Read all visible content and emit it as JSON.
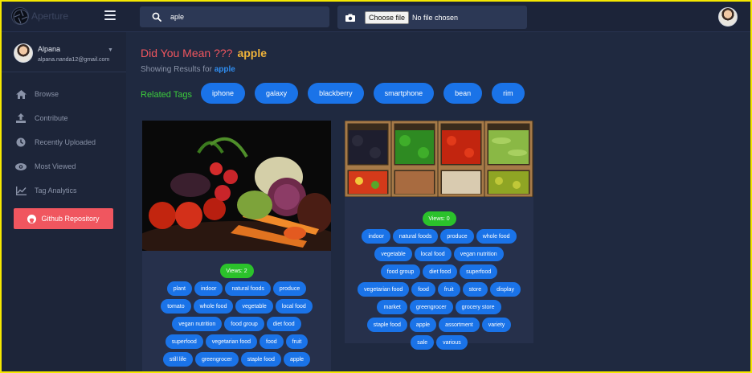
{
  "header": {
    "app_name": "Aperture",
    "search": {
      "value": "aple",
      "placeholder": ""
    },
    "upload": {
      "button_label": "Choose file",
      "status": "No file chosen"
    }
  },
  "sidebar": {
    "user": {
      "name": "Alpana",
      "email": "alpana.nanda12@gmail.com"
    },
    "items": [
      {
        "label": "Browse",
        "icon": "home-icon"
      },
      {
        "label": "Contribute",
        "icon": "upload-icon"
      },
      {
        "label": "Recently Uploaded",
        "icon": "clock-icon"
      },
      {
        "label": "Most Viewed",
        "icon": "eye-icon"
      },
      {
        "label": "Tag Analytics",
        "icon": "chart-icon"
      }
    ],
    "github_label": "Github Repository"
  },
  "main": {
    "did_you_mean": "Did You Mean ???",
    "suggestion": "apple",
    "showing_prefix": "Showing Results for",
    "query": "apple",
    "related_label": "Related Tags",
    "related_tags": [
      "iphone",
      "galaxy",
      "blackberry",
      "smartphone",
      "bean",
      "rim"
    ]
  },
  "cards": [
    {
      "views": "Views: 2",
      "tags": [
        "plant",
        "indoor",
        "natural foods",
        "produce",
        "tomato",
        "whole food",
        "vegetable",
        "local food",
        "vegan nutrition",
        "food group",
        "diet food",
        "superfood",
        "vegetarian food",
        "food",
        "fruit",
        "still life",
        "greengrocer",
        "staple food",
        "apple"
      ]
    },
    {
      "views": "Views: 0",
      "tags": [
        "indoor",
        "natural foods",
        "produce",
        "whole food",
        "vegetable",
        "local food",
        "vegan nutrition",
        "food group",
        "diet food",
        "superfood",
        "vegetarian food",
        "food",
        "fruit",
        "store",
        "display",
        "market",
        "greengrocer",
        "grocery store",
        "staple food",
        "apple",
        "assortment",
        "variety",
        "sale",
        "various"
      ]
    }
  ],
  "colors": {
    "accent_blue": "#1a73e8",
    "red": "#f0565f",
    "green": "#2bc22b",
    "orange": "#f0b33a"
  }
}
